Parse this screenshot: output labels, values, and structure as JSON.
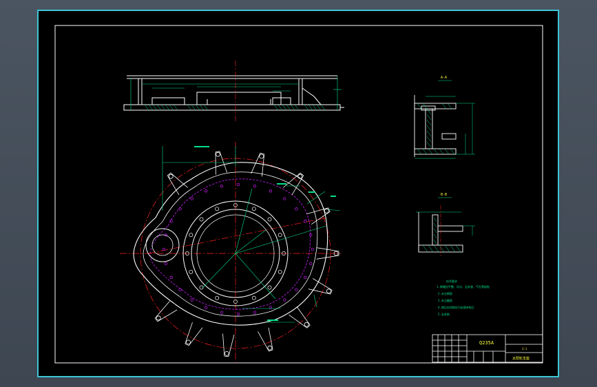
{
  "drawing": {
    "section_label_a": "A-A",
    "section_label_b": "B-B",
    "material": "Q235A",
    "scale_label": "1:1",
    "part_name": "太阳轮支座",
    "notes_title": "技术要求",
    "notes": [
      "1.焊缝应平整、均匀、无夹渣、气孔等缺陷",
      "2.未注倒角",
      "3.未注圆角",
      "4.焊后应消除应力处理并校正",
      "5.去毛刺"
    ]
  },
  "colors": {
    "frame": "#ffffff",
    "outline": "#ffffff",
    "dimension": "#00e08a",
    "centerline": "#ff2020",
    "hidden": "#d020ff",
    "text": "#ffff40",
    "border": "#3cc6d6"
  }
}
